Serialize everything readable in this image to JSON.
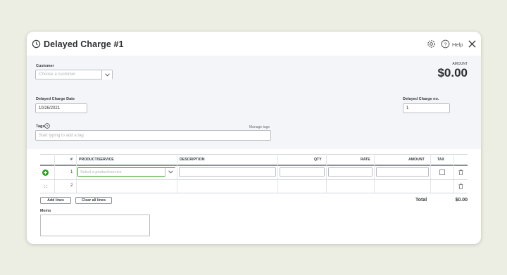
{
  "header": {
    "title": "Delayed Charge #1",
    "help_label": "Help",
    "amount_label": "AMOUNT",
    "amount_value": "$0.00"
  },
  "form": {
    "customer_label": "Customer",
    "customer_placeholder": "Choose a customer",
    "date_label": "Delayed Charge Date",
    "date_value": "10/26/2021",
    "charge_no_label": "Delayed Charge no.",
    "charge_no_value": "1",
    "tags_label": "Tags",
    "manage_tags": "Manage tags",
    "tags_placeholder": "Start typing to add a tag"
  },
  "table": {
    "columns": [
      "#",
      "PRODUCT/SERVICE",
      "DESCRIPTION",
      "QTY",
      "RATE",
      "AMOUNT",
      "TAX"
    ],
    "rows": [
      {
        "num": "1",
        "product_placeholder": "Select a product/service"
      },
      {
        "num": "2"
      }
    ]
  },
  "actions": {
    "add_lines": "Add lines",
    "clear_all_lines": "Clear all lines"
  },
  "totals": {
    "total_label": "Total",
    "total_value": "$0.00"
  },
  "memo": {
    "label": "Memo"
  },
  "colors": {
    "accent_green": "#2ca01c",
    "header_bg": "#f4f5f8",
    "page_bg": "#eceee3"
  },
  "icons": [
    "recurring-icon",
    "gear-icon",
    "help-icon",
    "close-icon",
    "chevron-down-icon",
    "add-line-icon",
    "drag-handle-icon",
    "trash-icon"
  ]
}
